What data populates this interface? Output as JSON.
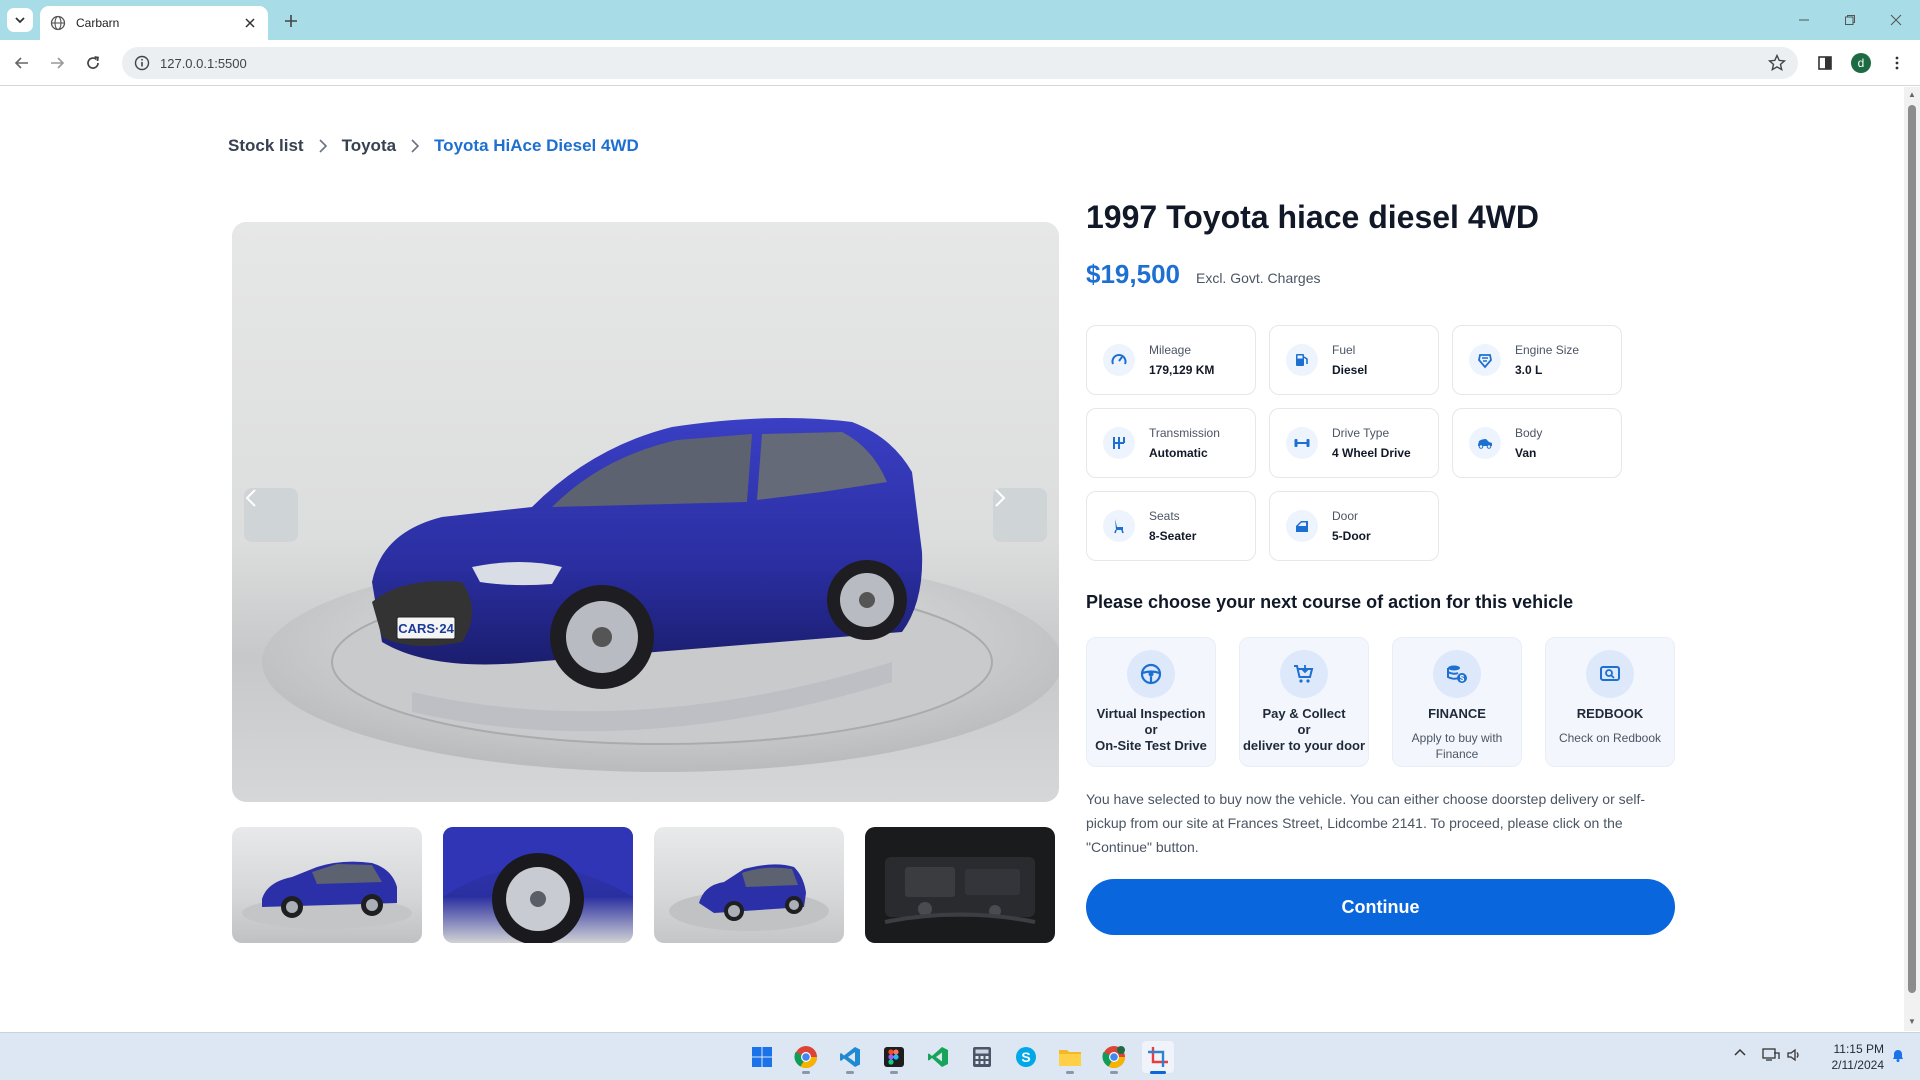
{
  "browser": {
    "tab_title": "Carbarn",
    "url": "127.0.0.1:5500",
    "profile_initial": "d"
  },
  "breadcrumb": {
    "items": [
      "Stock list",
      "Toyota"
    ],
    "current": "Toyota HiAce Diesel 4WD"
  },
  "gallery": {
    "plate_text": "CARS·24",
    "thumbnails": [
      "side-view",
      "wheel-closeup",
      "front-angle-view",
      "engine-bay"
    ]
  },
  "vehicle": {
    "title": "1997 Toyota hiace diesel 4WD",
    "price": "$19,500",
    "price_note": "Excl. Govt. Charges"
  },
  "specs": [
    {
      "label": "Mileage",
      "value": "179,129 KM",
      "icon": "speedometer-icon"
    },
    {
      "label": "Fuel",
      "value": "Diesel",
      "icon": "fuel-pump-icon"
    },
    {
      "label": "Engine Size",
      "value": "3.0 L",
      "icon": "engine-icon"
    },
    {
      "label": "Transmission",
      "value": "Automatic",
      "icon": "gear-shift-icon"
    },
    {
      "label": "Drive Type",
      "value": "4 Wheel Drive",
      "icon": "axle-icon"
    },
    {
      "label": "Body",
      "value": "Van",
      "icon": "car-body-icon"
    },
    {
      "label": "Seats",
      "value": "8-Seater",
      "icon": "seat-icon"
    },
    {
      "label": "Door",
      "value": "5-Door",
      "icon": "car-door-icon"
    }
  ],
  "course": {
    "heading": "Please choose your next course of action for this vehicle",
    "options": [
      {
        "title_lines": [
          "Virtual Inspection",
          "or",
          "On-Site Test Drive"
        ],
        "sub": "",
        "icon": "steering-wheel-icon"
      },
      {
        "title_lines": [
          "Pay & Collect",
          "or",
          "deliver to your door"
        ],
        "sub": "",
        "icon": "cart-icon"
      },
      {
        "title_lines": [
          "FINANCE"
        ],
        "sub": "Apply to buy with Finance",
        "icon": "coins-icon"
      },
      {
        "title_lines": [
          "REDBOOK"
        ],
        "sub": "Check on Redbook",
        "icon": "redbook-search-icon"
      }
    ],
    "description": "You have selected to buy now the vehicle. You can either choose doorstep delivery or self-pickup from our site at Frances Street, Lidcombe 2141. To proceed, please click on the \"Continue\" button.",
    "continue_label": "Continue"
  },
  "taskbar": {
    "apps": [
      "windows-start",
      "chrome",
      "vscode",
      "figma",
      "visual-studio",
      "calculator",
      "skype",
      "file-explorer",
      "chrome-profile",
      "snipping-tool"
    ],
    "time": "11:15 PM",
    "date": "2/11/2024"
  },
  "colors": {
    "accent": "#1d6fd1",
    "button": "#0a66dc",
    "tab_strip": "#a8dde7"
  }
}
